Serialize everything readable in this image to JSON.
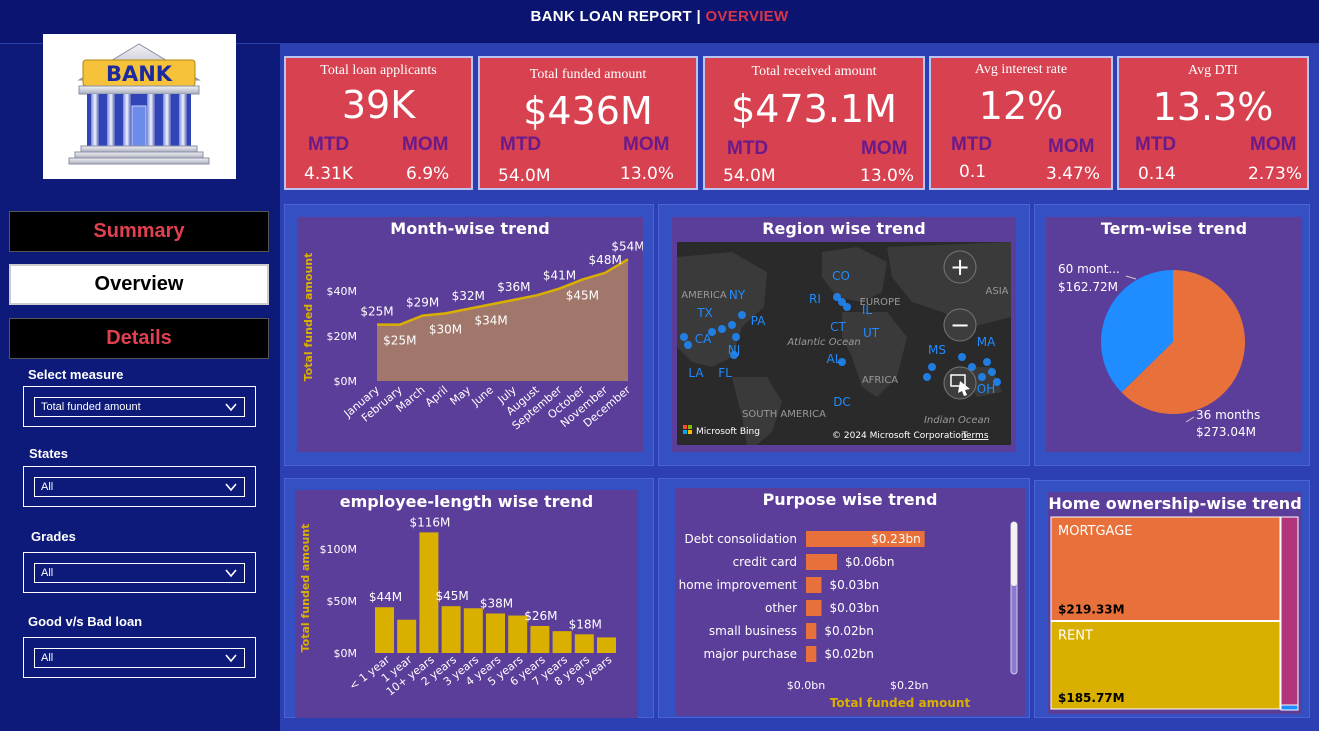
{
  "header": {
    "title": "BANK LOAN REPORT",
    "separator": " | ",
    "subtitle": "OVERVIEW"
  },
  "logo": {
    "text": "BANK"
  },
  "nav": {
    "summary": "Summary",
    "overview": "Overview",
    "details": "Details"
  },
  "filters": {
    "measure": {
      "label": "Select measure",
      "value": "Total funded amount"
    },
    "states": {
      "label": "States",
      "value": "All"
    },
    "grades": {
      "label": "Grades",
      "value": "All"
    },
    "loan_type": {
      "label": "Good v/s Bad loan",
      "value": "All"
    }
  },
  "kpis": [
    {
      "label": "Total loan applicants",
      "value": "39K",
      "mtd_label": "MTD",
      "mom_label": "MOM",
      "mtd": "4.31K",
      "mom": "6.9%"
    },
    {
      "label": "Total funded amount",
      "value": "$436M",
      "mtd_label": "MTD",
      "mom_label": "MOM",
      "mtd": "54.0M",
      "mom": "13.0%"
    },
    {
      "label": "Total received amount",
      "value": "$473.1M",
      "mtd_label": "MTD",
      "mom_label": "MOM",
      "mtd": "54.0M",
      "mom": "13.0%"
    },
    {
      "label": "Avg interest rate",
      "value": "12%",
      "mtd_label": "MTD",
      "mom_label": "MOM",
      "mtd": "0.1",
      "mom": "3.47%"
    },
    {
      "label": "Avg DTI",
      "value": "13.3%",
      "mtd_label": "MTD",
      "mom_label": "MOM",
      "mtd": "0.14",
      "mom": "2.73%"
    }
  ],
  "colors": {
    "kpi_bg": "#d84150",
    "accent_purple": "#6b1a8a",
    "orange": "#e8703a",
    "gold": "#d9b000",
    "blue": "#1f8cff",
    "magenta": "#b0357a"
  },
  "charts": {
    "month": {
      "title": "Month-wise trend",
      "ylabel": "Total funded amount",
      "yticks": [
        "$0M",
        "$20M",
        "$40M"
      ],
      "type": "area",
      "categories": [
        "January",
        "February",
        "March",
        "April",
        "May",
        "June",
        "July",
        "August",
        "September",
        "October",
        "November",
        "December"
      ],
      "values": [
        25,
        25,
        29,
        30,
        32,
        34,
        36,
        38,
        41,
        45,
        48,
        54
      ],
      "labels": [
        "$25M",
        "$25M",
        "$29M",
        "$30M",
        "$32M",
        "$34M",
        "$36M",
        "",
        "$41M",
        "$45M",
        "$48M",
        "$54M"
      ],
      "ylim": [
        0,
        55
      ]
    },
    "region": {
      "title": "Region wise trend",
      "map_labels": [
        "NY",
        "TX",
        "PA",
        "CA",
        "NJ",
        "LA",
        "FL",
        "RI",
        "CO",
        "CT",
        "IL",
        "UT",
        "AL",
        "DC",
        "MS",
        "MA",
        "OH",
        "AMERICA",
        "EUROPE",
        "ASIA",
        "AFRICA",
        "SOUTH AMERICA",
        "Atlantic Ocean",
        "Indian Ocean"
      ],
      "attribution": "Microsoft Bing",
      "copyright": "© 2024 Microsoft Corporation",
      "terms": "Terms"
    },
    "term": {
      "title": "Term-wise trend",
      "type": "pie",
      "slices": [
        {
          "name": "60 mont...",
          "value": 162.72,
          "label": "$162.72M",
          "color": "#1f8cff"
        },
        {
          "name": "36 months",
          "value": 273.04,
          "label": "$273.04M",
          "color": "#e8703a"
        }
      ]
    },
    "emp": {
      "title": "employee-length wise trend",
      "ylabel": "Total funded amount",
      "yticks": [
        "$0M",
        "$50M",
        "$100M"
      ],
      "type": "bar",
      "categories": [
        "< 1 year",
        "1 year",
        "10+ years",
        "2 years",
        "3 years",
        "4 years",
        "5 years",
        "6 years",
        "7 years",
        "8 years",
        "9 years"
      ],
      "values": [
        44,
        32,
        116,
        45,
        43,
        38,
        36,
        26,
        21,
        18,
        15
      ],
      "labels": [
        "$44M",
        "",
        "$116M",
        "$45M",
        "",
        "$38M",
        "",
        "$26M",
        "",
        "$18M",
        ""
      ],
      "ylim": [
        0,
        125
      ]
    },
    "purpose": {
      "title": "Purpose wise trend",
      "xlabel": "Total funded amount",
      "xticks": [
        "$0.0bn",
        "$0.2bn"
      ],
      "type": "bar",
      "categories": [
        "Debt consolidation",
        "credit card",
        "home improvement",
        "other",
        "small business",
        "major purchase"
      ],
      "values": [
        0.23,
        0.06,
        0.03,
        0.03,
        0.02,
        0.02
      ],
      "labels": [
        "$0.23bn",
        "$0.06bn",
        "$0.03bn",
        "$0.03bn",
        "$0.02bn",
        "$0.02bn"
      ],
      "xlim": [
        0,
        0.25
      ]
    },
    "home": {
      "title": "Home ownership-wise trend",
      "type": "treemap",
      "items": [
        {
          "name": "MORTGAGE",
          "label": "$219.33M",
          "value": 219.33,
          "color": "#e8703a"
        },
        {
          "name": "RENT",
          "label": "$185.77M",
          "value": 185.77,
          "color": "#d9b000"
        }
      ]
    }
  }
}
